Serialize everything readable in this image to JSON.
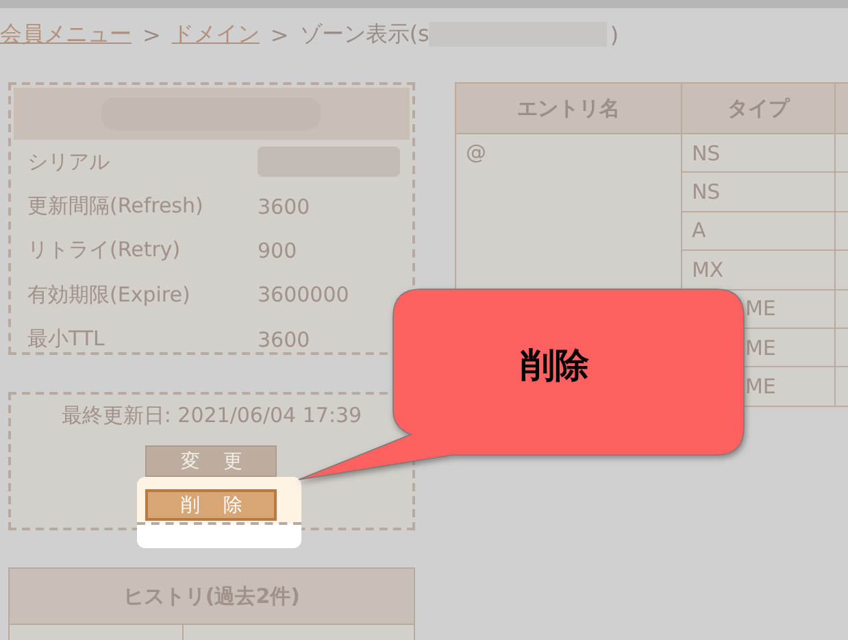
{
  "breadcrumb": [
    {
      "kind": "link",
      "text": "会員メニュー"
    },
    {
      "kind": "separator",
      "text": ">"
    },
    {
      "kind": "link",
      "text": "ドメイン"
    },
    {
      "kind": "separator",
      "text": ">"
    },
    {
      "kind": "current",
      "text": "ゾーン表示(s"
    },
    {
      "kind": "redacted"
    },
    {
      "kind": "current",
      "text": ")"
    }
  ],
  "soa_panel": {
    "rows": [
      {
        "label": "シリアル",
        "kind": "redacted"
      },
      {
        "label": "更新間隔(Refresh)",
        "kind": "value",
        "value": "3600"
      },
      {
        "label": "リトライ(Retry)",
        "kind": "value",
        "value": "900"
      },
      {
        "label": "有効期限(Expire)",
        "kind": "value",
        "value": "3600000"
      },
      {
        "label": "最小TTL",
        "kind": "value",
        "value": "3600"
      }
    ]
  },
  "action_panel": {
    "last_updated": "最終更新日: 2021/06/04 17:39",
    "buttons": [
      {
        "label": "変更",
        "disabled": true,
        "highlighted": false
      },
      {
        "label": "削除",
        "disabled": false,
        "highlighted": true
      }
    ]
  },
  "history_panel": {
    "title": "ヒストリ(過去2件)"
  },
  "zone_table": {
    "columns": [
      "エントリ名",
      "タイプ"
    ],
    "entry": "@",
    "types": [
      {
        "text": "NS",
        "covered": false
      },
      {
        "text": "NS",
        "covered": false
      },
      {
        "text": "A",
        "covered": false
      },
      {
        "text": "MX",
        "covered": false
      },
      {
        "text": "ME",
        "covered": true
      },
      {
        "text": "ME",
        "covered": true
      },
      {
        "text": "ME",
        "covered": true
      }
    ]
  },
  "callout": {
    "text": "削除"
  }
}
